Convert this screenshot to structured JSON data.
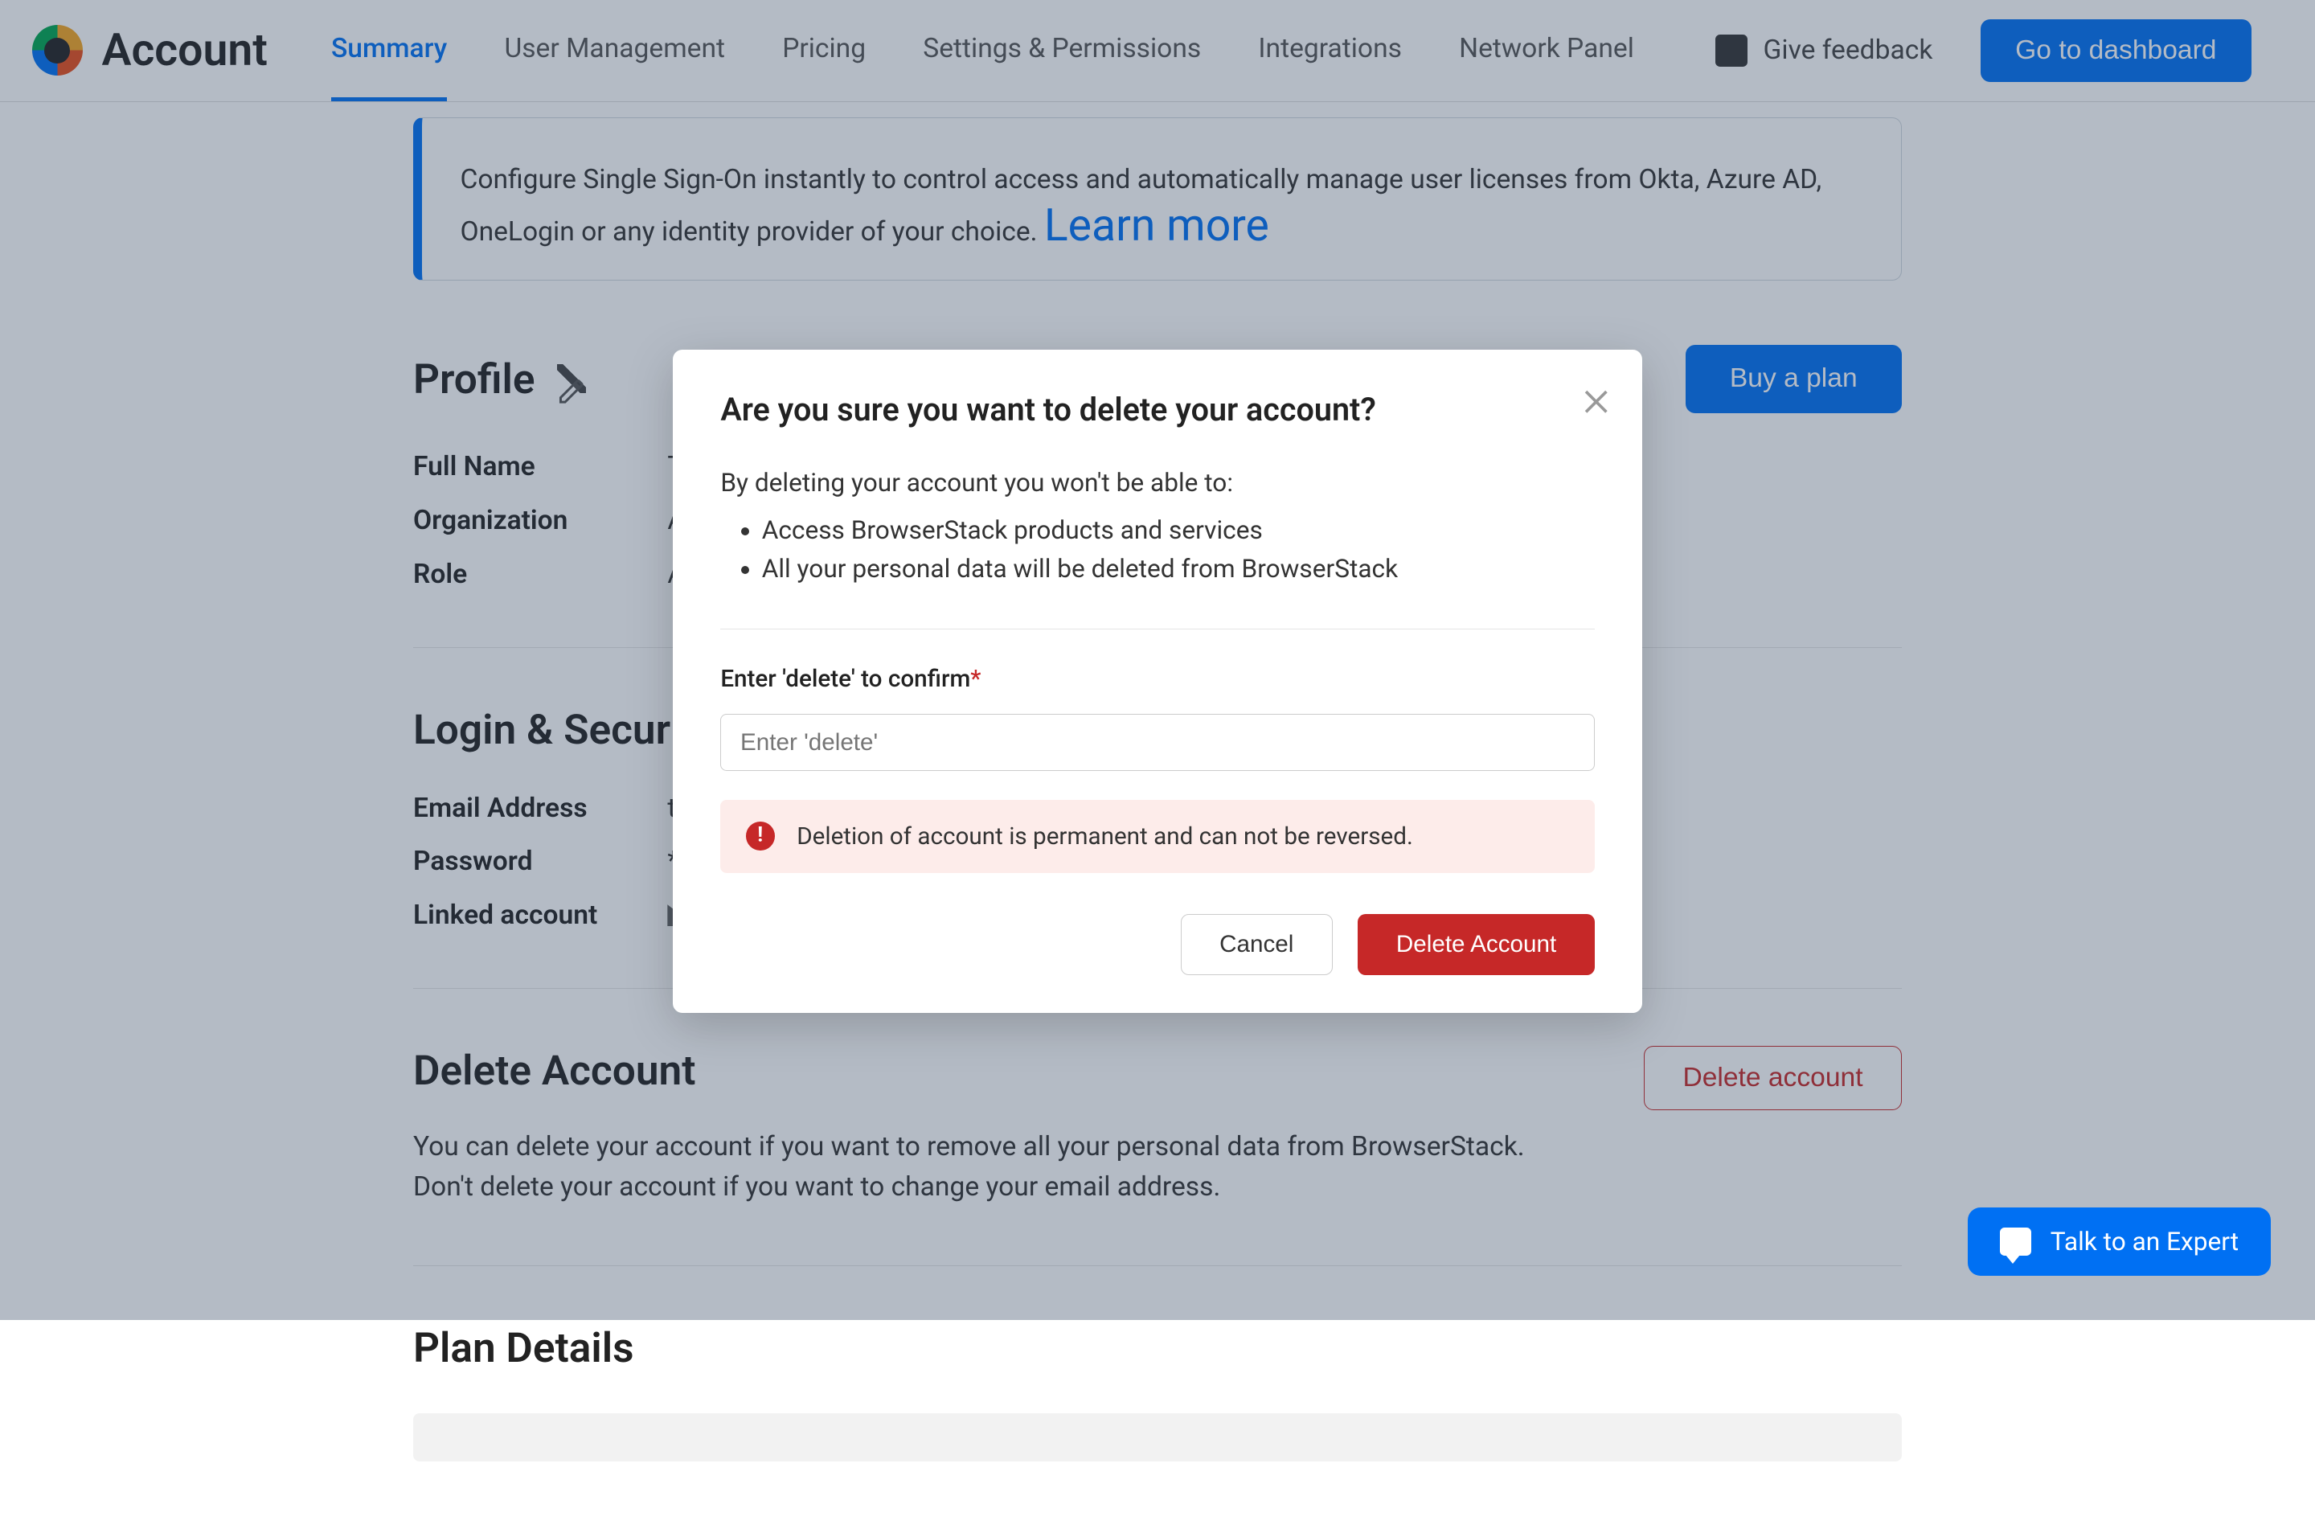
{
  "brand": {
    "title": "Account"
  },
  "nav": {
    "tabs": [
      "Summary",
      "User Management",
      "Pricing",
      "Settings & Permissions",
      "Integrations",
      "Network Panel"
    ],
    "active_index": 0,
    "feedback_label": "Give feedback",
    "dashboard_label": "Go to dashboard"
  },
  "sso": {
    "text": "Configure Single Sign-On instantly to control access and automatically manage user licenses from Okta, Azure AD, OneLogin or any identity provider of your choice. ",
    "link_label": "Learn more"
  },
  "profile": {
    "title": "Profile",
    "buy_label": "Buy a plan",
    "rows": {
      "full_name_label": "Full Name",
      "full_name_value": "Temp Temp",
      "organization_label": "Organization",
      "organization_value": "ABC",
      "role_label": "Role",
      "role_value": "Admi"
    }
  },
  "login": {
    "title": "Login & Security",
    "rows": {
      "email_label": "Email Address",
      "email_value": "temp",
      "password_label": "Password",
      "password_value": "*****",
      "linked_label": "Linked account",
      "linked_value": "E"
    }
  },
  "delete_section": {
    "title": "Delete Account",
    "desc_line1": "You can delete your account if you want to remove all your personal data from BrowserStack.",
    "desc_line2": "Don't delete your account if you want to change your email address.",
    "button_label": "Delete account"
  },
  "plan": {
    "title": "Plan Details"
  },
  "modal": {
    "title": "Are you sure you want to delete your account?",
    "intro": "By deleting your account you won't be able to:",
    "bullets": [
      "Access BrowserStack products and services",
      "All your personal data will be deleted from BrowserStack"
    ],
    "confirm_label": "Enter 'delete' to confirm",
    "confirm_required": "*",
    "placeholder": "Enter 'delete'",
    "warning": "Deletion of account is permanent and can not be reversed.",
    "cancel_label": "Cancel",
    "delete_label": "Delete Account"
  },
  "chat": {
    "label": "Talk to an Expert"
  }
}
